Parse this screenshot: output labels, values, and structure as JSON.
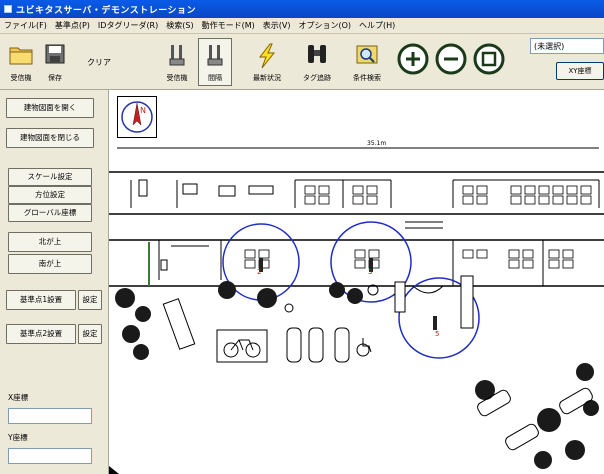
{
  "window": {
    "title": "ユビキタスサーバ・デモンストレーション"
  },
  "menu": [
    "ファイル(F)",
    "基準点(P)",
    "IDタグリーダ(R)",
    "検索(S)",
    "動作モード(M)",
    "表示(V)",
    "オプション(O)",
    "ヘルプ(H)"
  ],
  "toolbar": {
    "receive": "受信機",
    "save": "保存",
    "clear": "クリア",
    "receiver": "受信機",
    "interval": "間隔",
    "latest": "最新状況",
    "tag_trace": "タグ追跡",
    "condition_search": "条件検索",
    "selection": "(未選択)",
    "xy_button": "XY座標"
  },
  "sidebar": {
    "open_map": "建物図面を開く",
    "close_map": "建物図面を閉じる",
    "scale": "スケール設定",
    "direction": "方位設定",
    "global": "グローバル座標",
    "north_up": "北が上",
    "south_up": "南が上",
    "ref1": "基準点1設置",
    "ref2": "基準点2設置",
    "set1": "設定",
    "set2": "設定",
    "x_label": "X座標",
    "y_label": "Y座標"
  },
  "map": {
    "scale_text": "35.1m",
    "compass_letter": "N",
    "tags": [
      "2",
      "3",
      "5"
    ]
  },
  "colors": {
    "title_bar": "#0a5be8",
    "circle": "#1f2cc4",
    "tag": "#d01010"
  }
}
